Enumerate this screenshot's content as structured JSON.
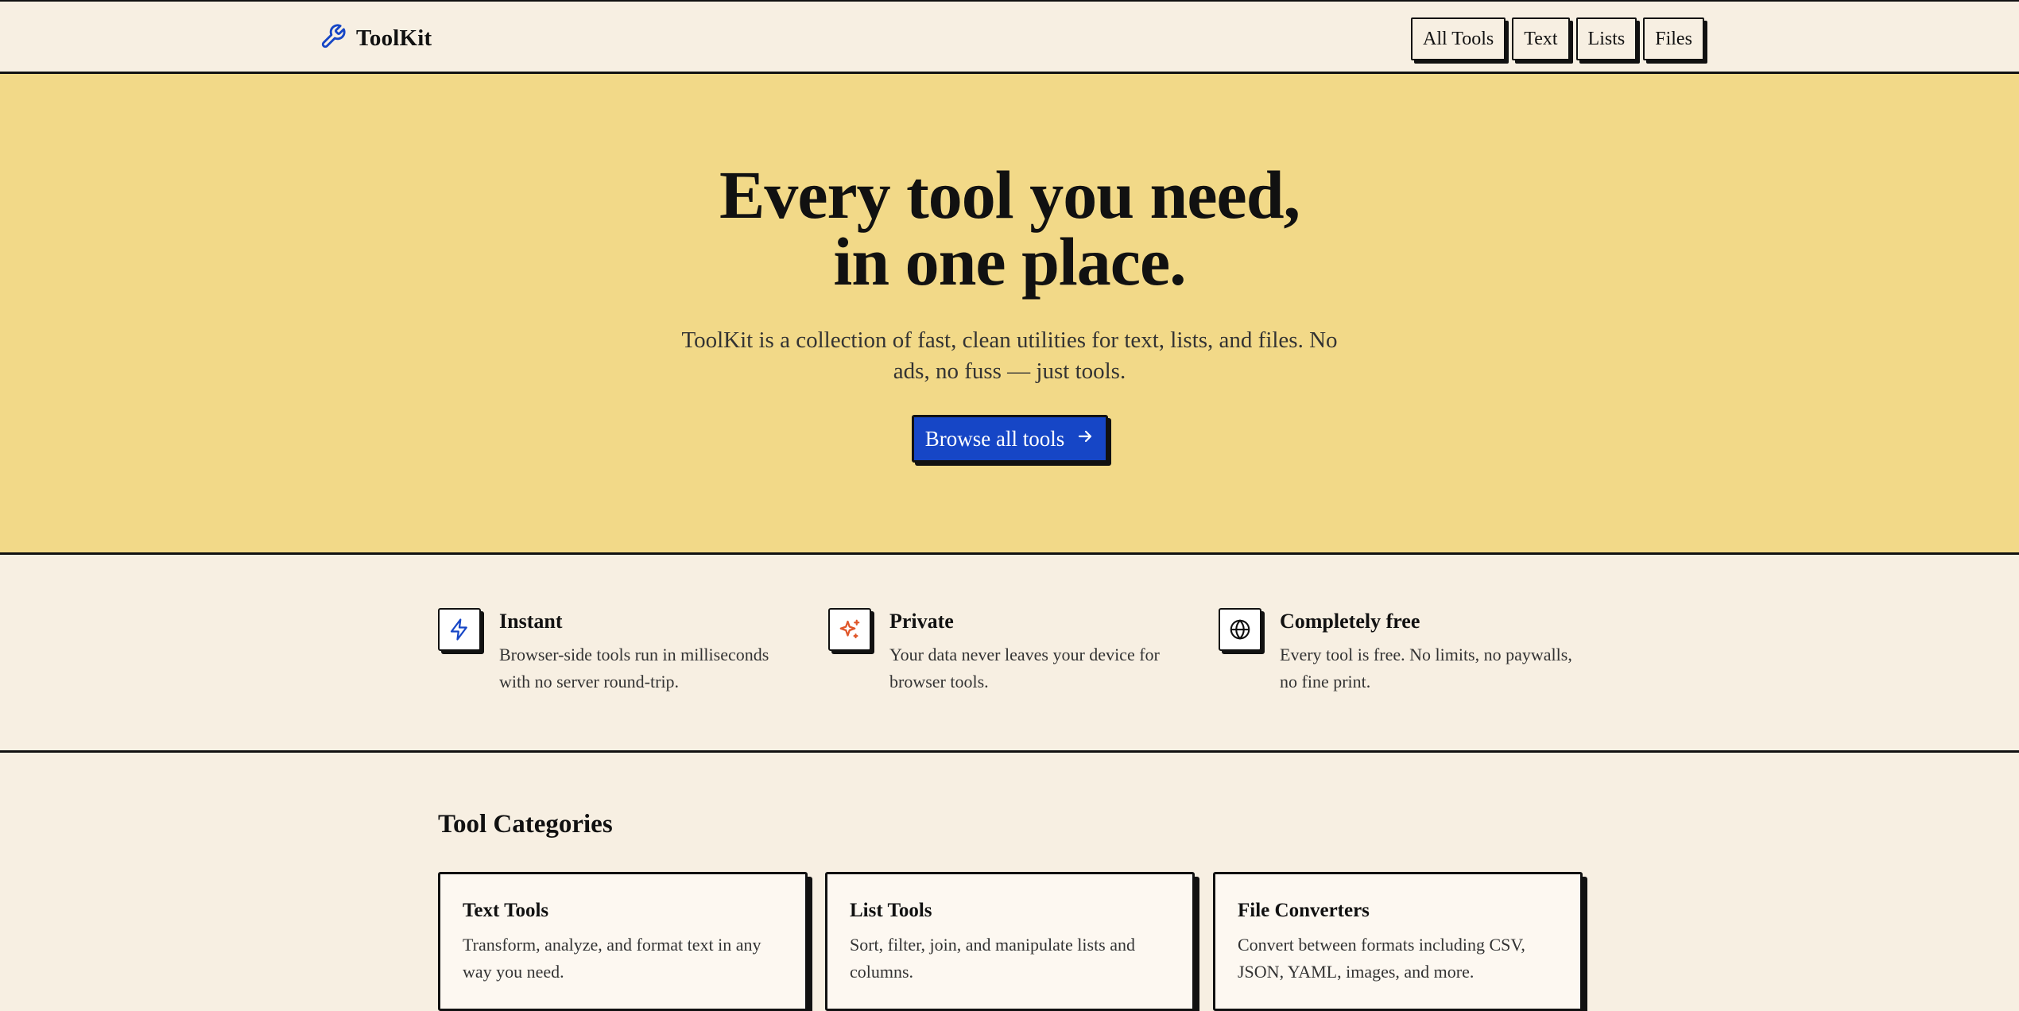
{
  "header": {
    "brand": "ToolKit",
    "nav": [
      "All Tools",
      "Text",
      "Lists",
      "Files"
    ]
  },
  "hero": {
    "title_line1": "Every tool you need,",
    "title_line2": "in one place.",
    "subtitle": "ToolKit is a collection of fast, clean utilities for text, lists, and files. No ads, no fuss — just tools.",
    "cta": "Browse all tools"
  },
  "features": [
    {
      "title": "Instant",
      "desc": "Browser-side tools run in milliseconds with no server round-trip.",
      "icon": "lightning-icon"
    },
    {
      "title": "Private",
      "desc": "Your data never leaves your device for browser tools.",
      "icon": "sparkle-icon"
    },
    {
      "title": "Completely free",
      "desc": "Every tool is free. No limits, no paywalls, no fine print.",
      "icon": "globe-icon"
    }
  ],
  "categories": {
    "heading": "Tool Categories",
    "items": [
      {
        "title": "Text Tools",
        "desc": "Transform, analyze, and format text in any way you need."
      },
      {
        "title": "List Tools",
        "desc": "Sort, filter, join, and manipulate lists and columns."
      },
      {
        "title": "File Converters",
        "desc": "Convert between formats including CSV, JSON, YAML, images, and more."
      }
    ]
  },
  "colors": {
    "background": "#f7efe2",
    "hero": "#f2d988",
    "accent": "#1646c6",
    "sparkle": "#e0572a"
  }
}
